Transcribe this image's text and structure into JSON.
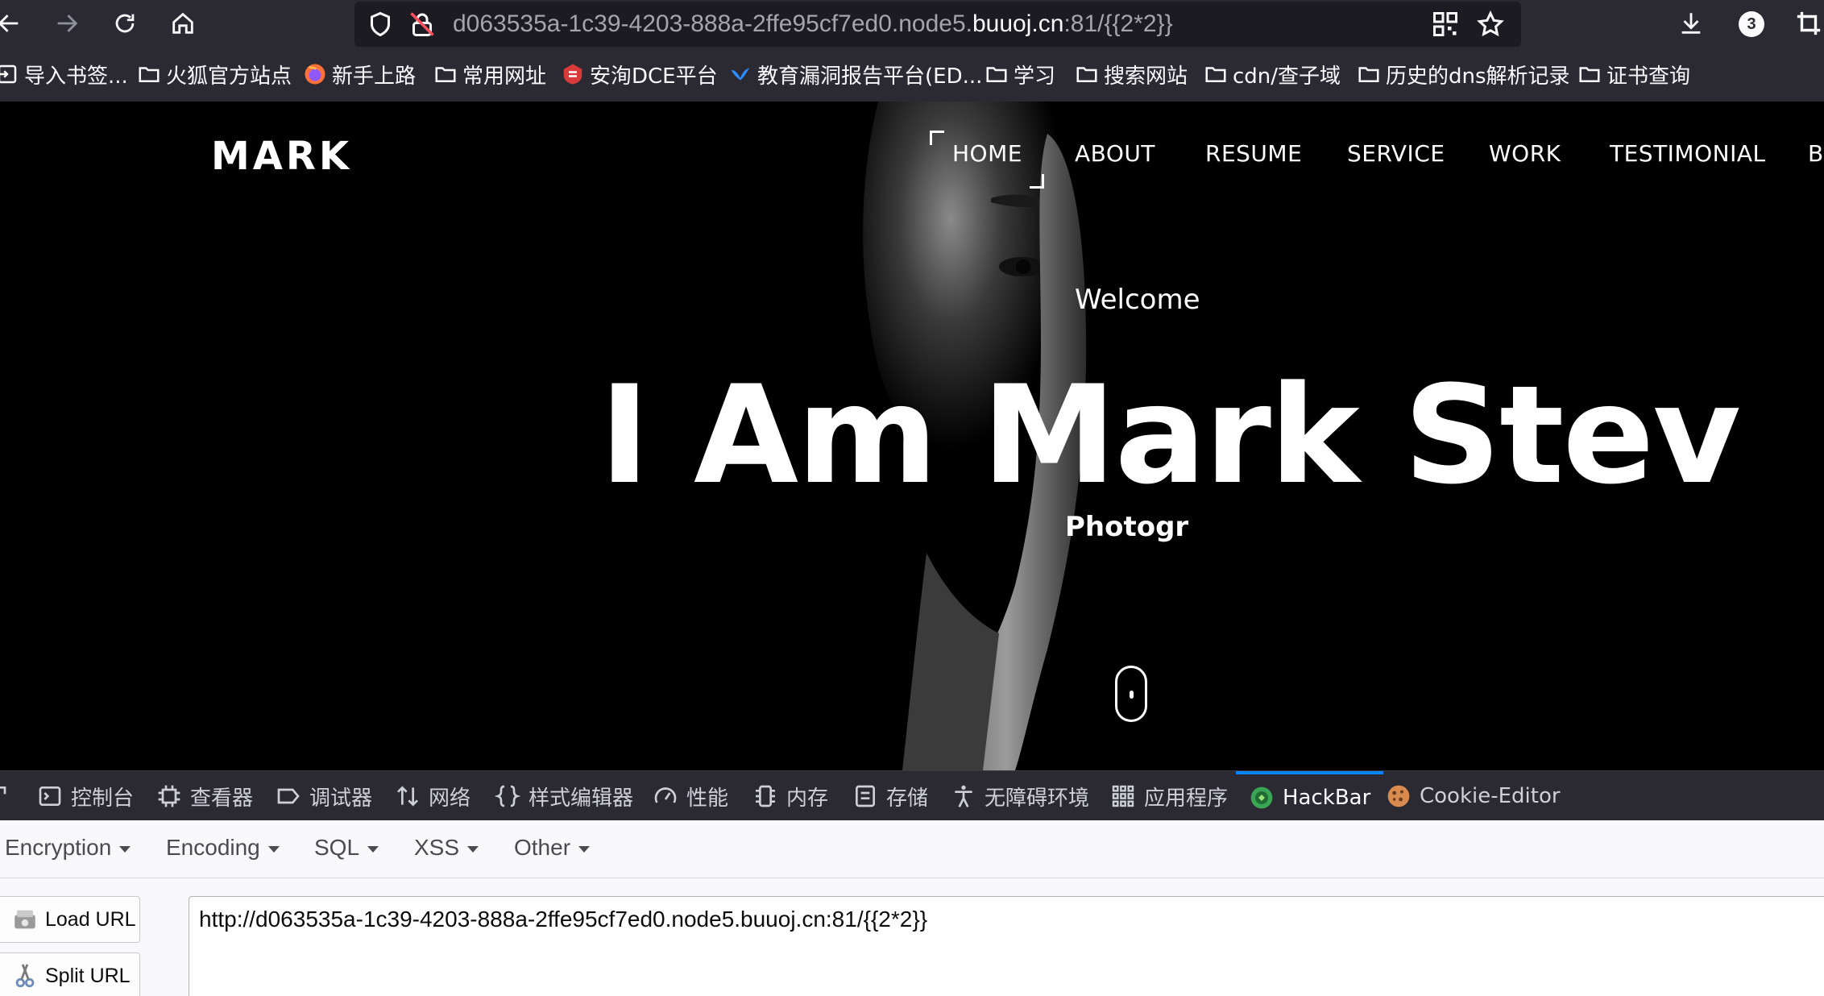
{
  "browser": {
    "url_prefix": "d063535a-1c39-4203-888a-2ffe95cf7ed0.node5.",
    "url_domain": "buuoj.cn",
    "url_suffix": ":81/{{2*2}}",
    "downloads_badge": "3"
  },
  "bookmarks": [
    {
      "label": "导入书签...",
      "icon": "import-icon"
    },
    {
      "label": "火狐官方站点",
      "icon": "folder-icon"
    },
    {
      "label": "新手上路",
      "icon": "firefox-icon"
    },
    {
      "label": "常用网址",
      "icon": "folder-icon"
    },
    {
      "label": "安洵DCE平台",
      "icon": "shield-logo-icon"
    },
    {
      "label": "教育漏洞报告平台(ED...",
      "icon": "bird-icon"
    },
    {
      "label": "学习",
      "icon": "folder-icon"
    },
    {
      "label": "搜索网站",
      "icon": "folder-icon"
    },
    {
      "label": "cdn/查子域",
      "icon": "folder-icon"
    },
    {
      "label": "历史的dns解析记录",
      "icon": "folder-icon"
    },
    {
      "label": "证书查询",
      "icon": "folder-icon"
    }
  ],
  "site": {
    "logo": "MARK",
    "nav": [
      "HOME",
      "ABOUT",
      "RESUME",
      "SERVICE",
      "WORK",
      "TESTIMONIAL",
      "B"
    ],
    "welcome": "Welcome",
    "headline": "I Am Mark Stev",
    "subtitle": "Photogr"
  },
  "devtools": {
    "tabs": [
      "控制台",
      "查看器",
      "调试器",
      "网络",
      "样式编辑器",
      "性能",
      "内存",
      "存储",
      "无障碍环境",
      "应用程序",
      "HackBar",
      "Cookie-Editor"
    ],
    "active_tab": "HackBar"
  },
  "hackbar": {
    "menu": [
      "Encryption",
      "Encoding",
      "SQL",
      "XSS",
      "Other"
    ],
    "load_url": "Load URL",
    "split_url": "Split URL",
    "url_value": "http://d063535a-1c39-4203-888a-2ffe95cf7ed0.node5.buuoj.cn:81/{{2*2}}"
  },
  "colors": {
    "chrome_bg": "#2b2a33",
    "urlbar_bg": "#1c1b22",
    "accent": "#0a84ff",
    "hero_bg": "#000000"
  }
}
